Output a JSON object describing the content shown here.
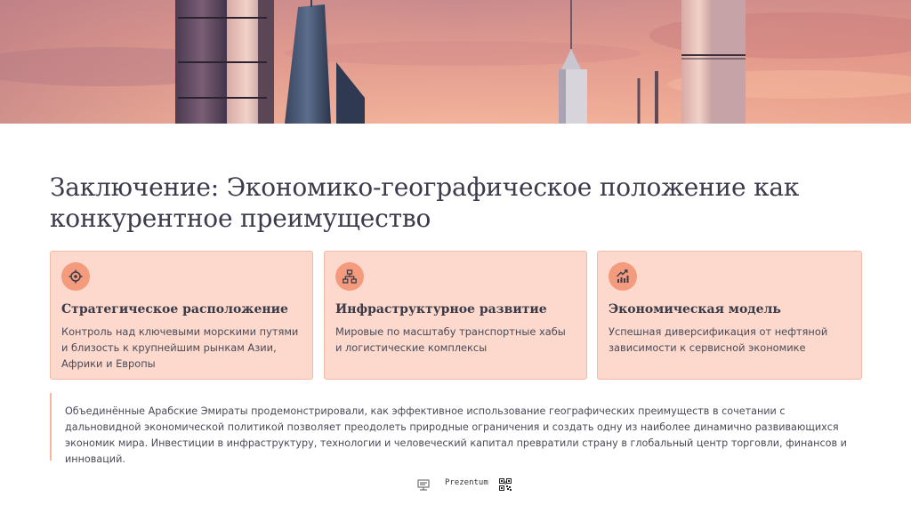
{
  "slide": {
    "title": "Заключение: Экономико-географическое положение как конкурентное преимущество",
    "cards": [
      {
        "icon": "target-icon",
        "title": "Стратегическое расположение",
        "text": "Контроль над ключевыми морскими путями и близость к крупнейшим рынкам Азии, Африки и Европы"
      },
      {
        "icon": "network-icon",
        "title": "Инфраструктурное развитие",
        "text": "Мировые по масштабу транспортные хабы и логистические комплексы"
      },
      {
        "icon": "growth-chart-icon",
        "title": "Экономическая модель",
        "text": "Успешная диверсификация от нефтяной зависимости к сервисной экономике"
      }
    ],
    "quote": "Объединённые Арабские Эмираты продемонстрировали, как эффективное использование географических преимуществ в сочетании с дальновидной экономической политикой позволяет преодолеть природные ограничения и создать одну из наиболее динамично развивающихся экономик мира. Инвестиции в инфраструктуру, технологии и человеческий капитал превратили страну в глобальный центр торговли, финансов и инноваций.",
    "footer": {
      "brand": "Prezentum"
    }
  },
  "colors": {
    "card_bg": "#fcd9cc",
    "card_border": "#f1b9a6",
    "icon_bg": "#f59b7d",
    "accent_bar": "#f3b6a2",
    "title_text": "#3b3b4c"
  }
}
